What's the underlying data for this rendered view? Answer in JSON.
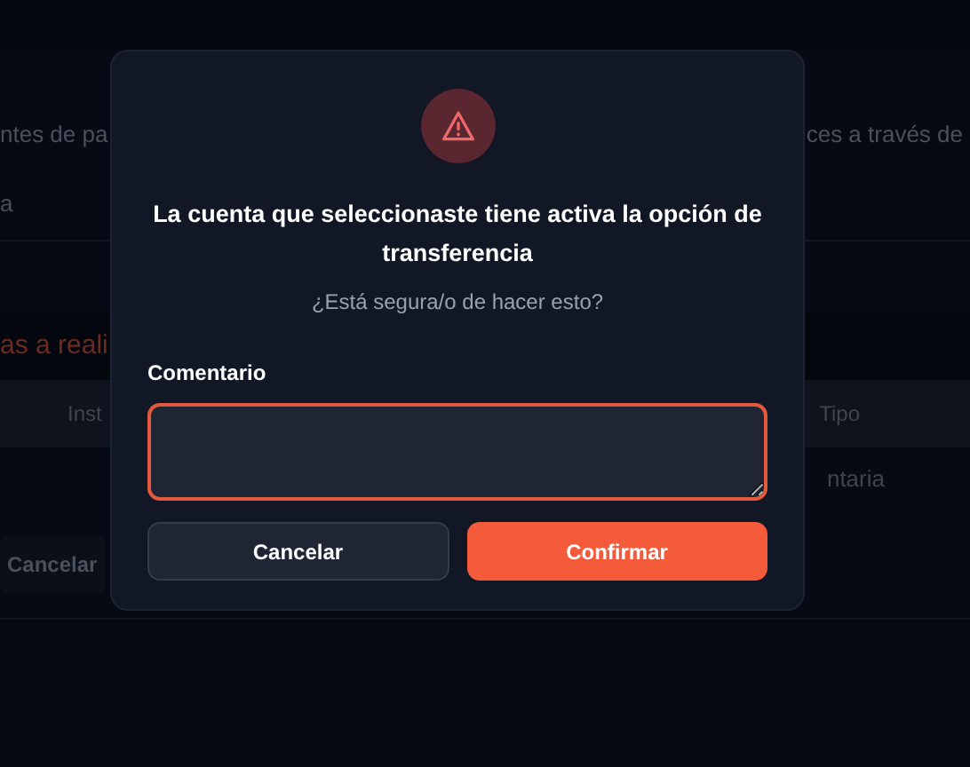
{
  "background": {
    "intro_left": "ntes de pa",
    "intro_right": "ces a través de",
    "row_label": "a",
    "section_title": "as a reali",
    "table": {
      "columns": [
        "Inst",
        "Tipo"
      ],
      "row": [
        "ntaria"
      ]
    },
    "cancel_button": "Cancelar"
  },
  "dialog": {
    "title": "La cuenta que seleccionaste tiene activa la opción de transferencia",
    "subtitle": "¿Está segura/o de hacer esto?",
    "field": {
      "label": "Comentario"
    },
    "buttons": [
      {
        "label": "Cancelar",
        "kind": "secondary"
      },
      {
        "label": "Confirmar",
        "kind": "primary"
      }
    ]
  }
}
